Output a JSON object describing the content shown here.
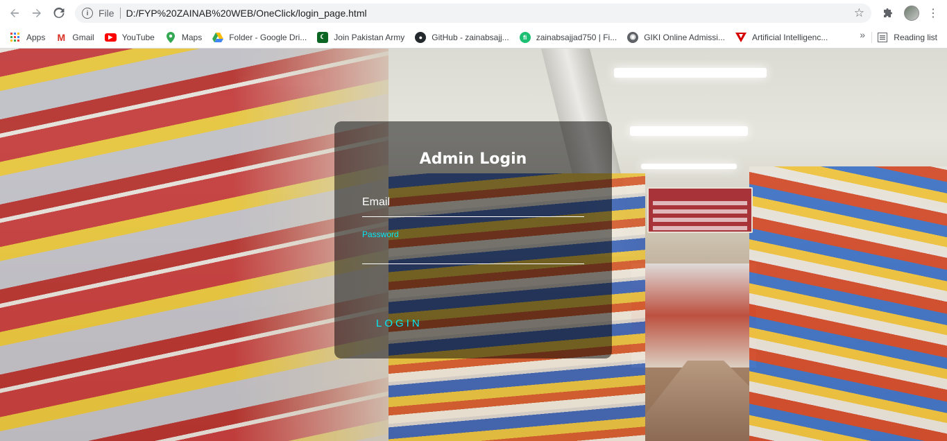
{
  "browser": {
    "url_scheme": "File",
    "url": "D:/FYP%20ZAINAB%20WEB/OneClick/login_page.html",
    "icons": [
      "back-arrow-icon",
      "forward-arrow-icon",
      "reload-icon",
      "info-icon",
      "star-icon",
      "puzzle-icon",
      "avatar",
      "menu-dots-icon"
    ]
  },
  "bookmarks": {
    "items": [
      {
        "label": "Apps",
        "icon": "apps-grid-icon",
        "color": "#ea4335"
      },
      {
        "label": "Gmail",
        "icon": "gmail-icon",
        "color": "#d93025"
      },
      {
        "label": "YouTube",
        "icon": "youtube-icon",
        "color": "#ff0000"
      },
      {
        "label": "Maps",
        "icon": "maps-pin-icon",
        "color": "#34a853"
      },
      {
        "label": "Folder - Google Dri...",
        "icon": "drive-icon",
        "color": "#fbbc04"
      },
      {
        "label": "Join Pakistan Army",
        "icon": "pakistan-army-icon",
        "color": "#0b6623"
      },
      {
        "label": "GitHub - zainabsajj...",
        "icon": "github-icon",
        "color": "#24292e"
      },
      {
        "label": "zainabsajjad750 | Fi...",
        "icon": "fiverr-icon",
        "color": "#1dbf73"
      },
      {
        "label": "GIKI Online Admissi...",
        "icon": "globe-icon",
        "color": "#5f6368"
      },
      {
        "label": "Artificial Intelligenc...",
        "icon": "ai-triangle-icon",
        "color": "#d50000"
      }
    ],
    "more": "»",
    "reading_list": "Reading list"
  },
  "login": {
    "title": "Admin Login",
    "email_label": "Email",
    "password_label": "Password",
    "button_label": "LOGIN",
    "accent_color": "#03e9f4"
  }
}
